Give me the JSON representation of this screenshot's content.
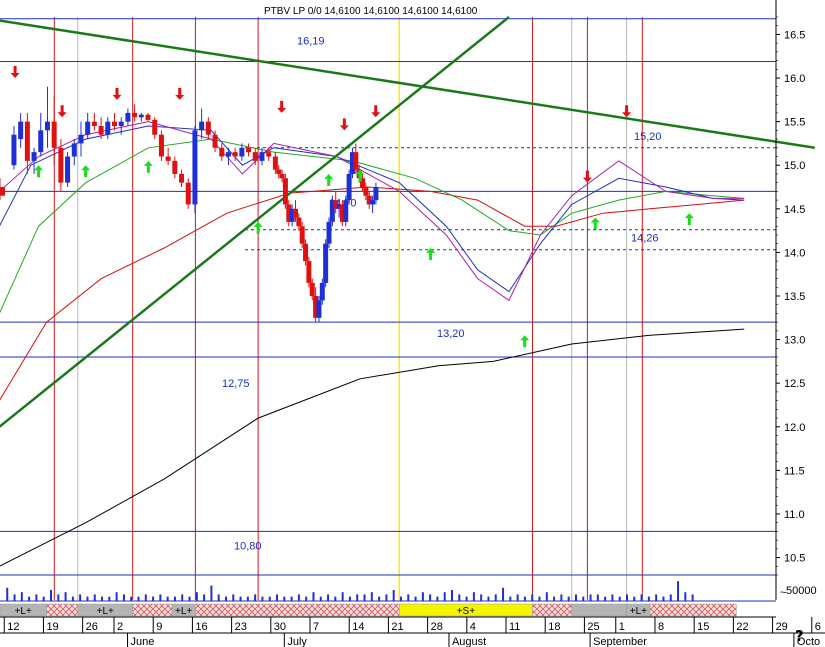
{
  "chart_data": {
    "type": "candlestick",
    "title": "PTBV LP 0/0 14,6100 14,6100 14,6100 14,6100",
    "y_axis": {
      "ylim": [
        10.3,
        16.7
      ],
      "ticks": [
        10.5,
        11.0,
        11.5,
        12.0,
        12.5,
        13.0,
        13.5,
        14.0,
        14.5,
        15.0,
        15.5,
        16.0,
        16.5
      ],
      "tick_labels": [
        "10.5",
        "11.0",
        "11.5",
        "12.0",
        "12.5",
        "13.0",
        "13.5",
        "14.0",
        "14.5",
        "15.0",
        "15.5",
        "16.0",
        "16.5"
      ]
    },
    "x_axis": {
      "day_ticks": [
        {
          "i": 0,
          "label": "12"
        },
        {
          "i": 5,
          "label": "19"
        },
        {
          "i": 10,
          "label": "26"
        },
        {
          "i": 14,
          "label": "2"
        },
        {
          "i": 19,
          "label": "9"
        },
        {
          "i": 24,
          "label": "16"
        },
        {
          "i": 29,
          "label": "23"
        },
        {
          "i": 34,
          "label": "30"
        },
        {
          "i": 39,
          "label": "7"
        },
        {
          "i": 44,
          "label": "14"
        },
        {
          "i": 49,
          "label": "21"
        },
        {
          "i": 54,
          "label": "28"
        },
        {
          "i": 59,
          "label": "4"
        },
        {
          "i": 64,
          "label": "11"
        },
        {
          "i": 69,
          "label": "18"
        },
        {
          "i": 74,
          "label": "25"
        },
        {
          "i": 78,
          "label": "1"
        },
        {
          "i": 83,
          "label": "8"
        },
        {
          "i": 88,
          "label": "15"
        },
        {
          "i": 93,
          "label": "22"
        },
        {
          "i": 98,
          "label": "29"
        },
        {
          "i": 103,
          "label": "6"
        }
      ],
      "month_labels": [
        {
          "i": 17,
          "label": "June"
        },
        {
          "i": 37,
          "label": "July"
        },
        {
          "i": 58,
          "label": "August"
        },
        {
          "i": 76,
          "label": "September"
        },
        {
          "i": 102,
          "label": "Octo"
        }
      ]
    },
    "horizontal_levels": [
      {
        "value": 16.68,
        "label": "",
        "style": "solid"
      },
      {
        "value": 16.19,
        "label": "16,19",
        "style": "solid"
      },
      {
        "value": 15.2,
        "label": "15,20",
        "style": "dashed"
      },
      {
        "value": 14.7,
        "label": "14,70",
        "style": "solid"
      },
      {
        "value": 14.26,
        "label": "14,26",
        "style": "dashed"
      },
      {
        "value": 14.03,
        "label": "",
        "style": "dashed"
      },
      {
        "value": 13.2,
        "label": "13,20",
        "style": "solid"
      },
      {
        "value": 12.8,
        "label": "12,75",
        "style": "solid"
      },
      {
        "value": 10.8,
        "label": "10,80",
        "style": "solid"
      },
      {
        "value": 10.3,
        "label": "",
        "style": "solid"
      }
    ],
    "vertical_markers": {
      "red": [
        6,
        16,
        24,
        32,
        67,
        74,
        81
      ],
      "gray": [
        9,
        72,
        79
      ],
      "yellow": [
        50
      ]
    },
    "trend_lines": [
      {
        "from": [
          -1,
          16.66
        ],
        "to": [
          103,
          15.2
        ],
        "color": "#1a7a1a"
      },
      {
        "from": [
          -1,
          12.0
        ],
        "to": [
          64,
          16.7
        ],
        "color": "#1a7a1a"
      }
    ],
    "candles": [
      [
        15.0,
        15.45,
        14.95,
        15.35
      ],
      [
        15.3,
        15.6,
        15.2,
        15.5
      ],
      [
        15.5,
        15.6,
        14.9,
        15.05
      ],
      [
        15.05,
        15.2,
        14.9,
        15.15
      ],
      [
        15.15,
        15.6,
        15.1,
        15.4
      ],
      [
        15.4,
        15.9,
        15.2,
        15.5
      ],
      [
        15.5,
        15.8,
        15.0,
        15.2
      ],
      [
        15.2,
        15.3,
        14.7,
        14.8
      ],
      [
        14.8,
        15.15,
        14.75,
        15.1
      ],
      [
        15.1,
        15.3,
        15.0,
        15.25
      ],
      [
        15.25,
        15.5,
        15.1,
        15.35
      ],
      [
        15.35,
        15.6,
        15.3,
        15.5
      ],
      [
        15.5,
        15.6,
        15.4,
        15.45
      ],
      [
        15.45,
        15.55,
        15.3,
        15.35
      ],
      [
        15.35,
        15.55,
        15.3,
        15.5
      ],
      [
        15.5,
        15.6,
        15.4,
        15.45
      ],
      [
        15.45,
        15.55,
        15.35,
        15.5
      ],
      [
        15.5,
        15.65,
        15.45,
        15.6
      ],
      [
        15.6,
        15.7,
        15.5,
        15.55
      ],
      [
        15.55,
        15.6,
        15.5,
        15.58
      ],
      [
        15.58,
        15.6,
        15.5,
        15.52
      ],
      [
        15.52,
        15.55,
        15.3,
        15.35
      ],
      [
        15.35,
        15.4,
        15.05,
        15.1
      ],
      [
        15.1,
        15.2,
        15.0,
        15.05
      ],
      [
        15.05,
        15.1,
        14.85,
        14.9
      ],
      [
        14.9,
        14.95,
        14.75,
        14.8
      ],
      [
        14.8,
        14.85,
        14.5,
        14.55
      ],
      [
        14.55,
        15.45,
        14.45,
        15.4
      ],
      [
        15.4,
        15.65,
        15.3,
        15.5
      ],
      [
        15.5,
        15.55,
        15.3,
        15.35
      ],
      [
        15.35,
        15.4,
        15.15,
        15.2
      ],
      [
        15.2,
        15.25,
        15.05,
        15.1
      ],
      [
        15.1,
        15.2,
        15.0,
        15.15
      ],
      [
        15.15,
        15.2,
        15.05,
        15.1
      ],
      [
        15.1,
        15.25,
        15.05,
        15.2
      ],
      [
        15.2,
        15.25,
        15.1,
        15.15
      ],
      [
        15.15,
        15.2,
        15.0,
        15.05
      ],
      [
        15.05,
        15.2,
        15.0,
        15.15
      ],
      [
        15.15,
        15.2,
        15.05,
        15.1
      ],
      [
        15.1,
        15.15,
        14.9,
        14.95
      ],
      [
        14.95,
        15.0,
        14.85,
        14.9
      ],
      [
        14.9,
        14.95,
        14.8,
        14.85
      ],
      [
        14.85,
        14.9,
        14.5,
        14.55
      ],
      [
        14.55,
        14.6,
        14.3,
        14.35
      ],
      [
        14.35,
        14.55,
        14.3,
        14.5
      ],
      [
        14.5,
        14.6,
        14.35,
        14.4
      ],
      [
        14.4,
        14.45,
        14.25,
        14.3
      ],
      [
        14.3,
        14.35,
        14.05,
        14.1
      ],
      [
        14.1,
        14.15,
        13.85,
        13.9
      ],
      [
        13.9,
        13.95,
        13.6,
        13.65
      ],
      [
        13.65,
        13.7,
        13.45,
        13.5
      ],
      [
        13.5,
        13.6,
        13.2,
        13.25
      ],
      [
        13.25,
        13.5,
        13.2,
        13.45
      ],
      [
        13.45,
        13.7,
        13.4,
        13.65
      ],
      [
        13.65,
        14.15,
        13.6,
        14.1
      ],
      [
        14.1,
        14.4,
        14.05,
        14.35
      ],
      [
        14.35,
        14.65,
        14.3,
        14.6
      ],
      [
        14.6,
        14.7,
        14.45,
        14.5
      ],
      [
        14.5,
        14.6,
        14.4,
        14.55
      ],
      [
        14.55,
        14.6,
        14.3,
        14.35
      ],
      [
        14.35,
        14.65,
        14.3,
        14.6
      ],
      [
        14.6,
        14.95,
        14.55,
        14.9
      ],
      [
        14.9,
        15.2,
        14.85,
        15.15
      ],
      [
        15.15,
        15.25,
        14.9,
        14.95
      ],
      [
        14.95,
        15.0,
        14.8,
        14.85
      ],
      [
        14.85,
        14.9,
        14.7,
        14.75
      ],
      [
        14.75,
        14.8,
        14.6,
        14.65
      ],
      [
        14.65,
        14.7,
        14.5,
        14.55
      ],
      [
        14.55,
        14.65,
        14.45,
        14.6
      ],
      [
        14.6,
        14.8,
        14.55,
        14.75
      ],
      [
        14.75,
        14.85,
        14.6,
        14.65
      ]
    ],
    "candle_slots": [
      2,
      4,
      6,
      8,
      10,
      12,
      14,
      16,
      18,
      20,
      22,
      24,
      26,
      28,
      30,
      32,
      34,
      36,
      38,
      40,
      42,
      44,
      46,
      48,
      50,
      52,
      54,
      56,
      58,
      60,
      62,
      64,
      66,
      68,
      70,
      72,
      74,
      76,
      78,
      80,
      81,
      82,
      83,
      84,
      85,
      86,
      87,
      88,
      89,
      90,
      91,
      92,
      93,
      94,
      95,
      96,
      97,
      98,
      99,
      100,
      101,
      102,
      103,
      104,
      105,
      106,
      107,
      108,
      109,
      110
    ],
    "moving_averages": [
      {
        "color": "#d01010",
        "points": [
          [
            -1,
            12.3
          ],
          [
            5,
            13.2
          ],
          [
            12,
            13.7
          ],
          [
            20,
            14.05
          ],
          [
            28,
            14.45
          ],
          [
            36,
            14.68
          ],
          [
            46,
            14.75
          ],
          [
            54,
            14.7
          ],
          [
            60,
            14.6
          ],
          [
            66,
            14.3
          ],
          [
            70,
            14.3
          ],
          [
            76,
            14.45
          ],
          [
            82,
            14.5
          ],
          [
            88,
            14.55
          ],
          [
            94,
            14.6
          ]
        ]
      },
      {
        "color": "#22aa22",
        "points": [
          [
            -1,
            13.3
          ],
          [
            4,
            14.3
          ],
          [
            10,
            14.8
          ],
          [
            18,
            15.2
          ],
          [
            26,
            15.3
          ],
          [
            34,
            15.15
          ],
          [
            44,
            15.05
          ],
          [
            52,
            14.85
          ],
          [
            58,
            14.6
          ],
          [
            64,
            14.25
          ],
          [
            68,
            14.2
          ],
          [
            72,
            14.45
          ],
          [
            78,
            14.6
          ],
          [
            84,
            14.7
          ],
          [
            90,
            14.65
          ],
          [
            94,
            14.62
          ]
        ]
      },
      {
        "color": "#1f2fbf",
        "points": [
          [
            -1,
            14.3
          ],
          [
            3,
            15.0
          ],
          [
            10,
            15.3
          ],
          [
            18,
            15.45
          ],
          [
            26,
            15.4
          ],
          [
            30,
            15.0
          ],
          [
            34,
            15.2
          ],
          [
            42,
            15.1
          ],
          [
            50,
            14.8
          ],
          [
            56,
            14.3
          ],
          [
            60,
            13.8
          ],
          [
            64,
            13.55
          ],
          [
            68,
            14.1
          ],
          [
            72,
            14.55
          ],
          [
            78,
            14.85
          ],
          [
            84,
            14.75
          ],
          [
            90,
            14.62
          ],
          [
            94,
            14.6
          ]
        ]
      },
      {
        "color": "#aa22aa",
        "points": [
          [
            -1,
            14.7
          ],
          [
            4,
            15.1
          ],
          [
            10,
            15.35
          ],
          [
            18,
            15.5
          ],
          [
            26,
            15.3
          ],
          [
            30,
            14.9
          ],
          [
            34,
            15.25
          ],
          [
            42,
            15.1
          ],
          [
            50,
            14.7
          ],
          [
            56,
            14.2
          ],
          [
            60,
            13.7
          ],
          [
            64,
            13.45
          ],
          [
            68,
            14.2
          ],
          [
            72,
            14.65
          ],
          [
            78,
            15.05
          ],
          [
            84,
            14.7
          ],
          [
            90,
            14.62
          ],
          [
            94,
            14.62
          ]
        ]
      },
      {
        "color": "#000000",
        "points": [
          [
            -1,
            10.4
          ],
          [
            10,
            10.9
          ],
          [
            20,
            11.4
          ],
          [
            32,
            12.1
          ],
          [
            45,
            12.55
          ],
          [
            55,
            12.7
          ],
          [
            62,
            12.75
          ],
          [
            72,
            12.95
          ],
          [
            82,
            13.05
          ],
          [
            94,
            13.12
          ]
        ]
      }
    ],
    "signal_arrows": [
      {
        "i": 1,
        "dir": "down",
        "value": 16.0
      },
      {
        "i": 7,
        "dir": "down",
        "value": 15.55
      },
      {
        "i": 14,
        "dir": "down",
        "value": 15.75
      },
      {
        "i": 22,
        "dir": "down",
        "value": 15.75
      },
      {
        "i": 35,
        "dir": "down",
        "value": 15.6
      },
      {
        "i": 43,
        "dir": "down",
        "value": 15.4
      },
      {
        "i": 47,
        "dir": "down",
        "value": 15.55
      },
      {
        "i": 74,
        "dir": "down",
        "value": 14.8
      },
      {
        "i": 79,
        "dir": "down",
        "value": 15.55
      },
      {
        "i": 4,
        "dir": "up",
        "value": 15.0
      },
      {
        "i": 10,
        "dir": "up",
        "value": 15.0
      },
      {
        "i": 18,
        "dir": "up",
        "value": 15.05
      },
      {
        "i": 32,
        "dir": "up",
        "value": 14.35
      },
      {
        "i": 41,
        "dir": "up",
        "value": 14.9
      },
      {
        "i": 45,
        "dir": "up",
        "value": 14.95
      },
      {
        "i": 54,
        "dir": "up",
        "value": 14.05
      },
      {
        "i": 66,
        "dir": "up",
        "value": 13.05
      },
      {
        "i": 75,
        "dir": "up",
        "value": 14.4
      },
      {
        "i": 87,
        "dir": "up",
        "value": 14.45
      }
    ],
    "volume": {
      "label": "50000",
      "bars": [
        0.6,
        0.3,
        0.4,
        0.2,
        0.3,
        0.2,
        0.5,
        0.3,
        0.4,
        0.2,
        0.3,
        0.2,
        0.3,
        0.2,
        0.2,
        0.4,
        0.3,
        0.2,
        0.2,
        0.3,
        0.2,
        0.3,
        0.2,
        0.2,
        0.3,
        0.2,
        0.4,
        0.3,
        0.7,
        0.3,
        0.2,
        0.3,
        0.2,
        0.2,
        0.3,
        0.2,
        0.2,
        0.3,
        0.2,
        0.2,
        0.3,
        0.2,
        0.4,
        0.2,
        0.3,
        0.2,
        0.4,
        0.2,
        0.3,
        0.3,
        0.4,
        0.2,
        0.3,
        0.5,
        0.2,
        0.3,
        0.2,
        0.4,
        0.3,
        0.2,
        0.4,
        0.5,
        0.3,
        0.2,
        0.4,
        0.3,
        0.2,
        0.3,
        0.6,
        0.2,
        0.3,
        0.2,
        0.3,
        0.2,
        0.4,
        0.2,
        0.3,
        0.2,
        0.3,
        0.2,
        0.3,
        0.3,
        0.2,
        0.3,
        0.2,
        0.3,
        0.2,
        0.3,
        0.2,
        0.3,
        0.2,
        0.3,
        0.9,
        0.4,
        0.3
      ]
    },
    "signal_bands": [
      {
        "from": -1,
        "to": 5,
        "label": "+L+",
        "color": "#b4b4b4"
      },
      {
        "from": 5,
        "to": 9,
        "label": "",
        "color": "hatch"
      },
      {
        "from": 9,
        "to": 16,
        "label": "+L+",
        "color": "#b4b4b4"
      },
      {
        "from": 16,
        "to": 21,
        "label": "",
        "color": "hatch"
      },
      {
        "from": 21,
        "to": 24,
        "label": "+L+",
        "color": "#b4b4b4"
      },
      {
        "from": 24,
        "to": 50,
        "label": "",
        "color": "hatch"
      },
      {
        "from": 50,
        "to": 67,
        "label": "+S+",
        "color": "#f4f400"
      },
      {
        "from": 67,
        "to": 72,
        "label": "",
        "color": "hatch"
      },
      {
        "from": 72,
        "to": 79,
        "label": "",
        "color": "#b4b4b4"
      },
      {
        "from": 79,
        "to": 82,
        "label": "+L+",
        "color": "#b4b4b4"
      },
      {
        "from": 82,
        "to": 93,
        "label": "",
        "color": "hatch"
      }
    ],
    "help_glyph": "?"
  }
}
